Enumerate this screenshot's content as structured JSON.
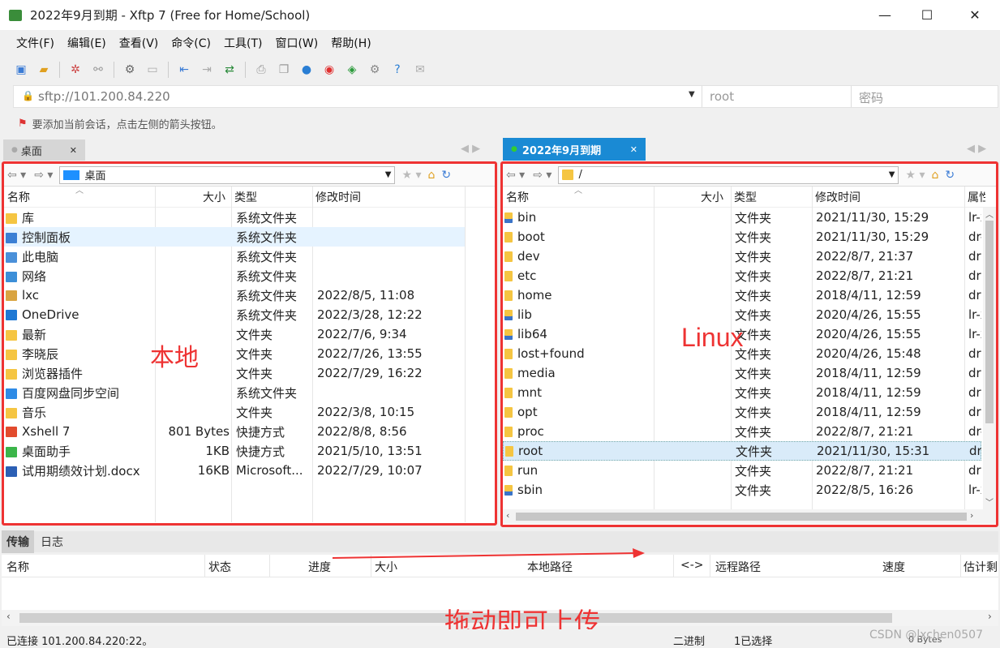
{
  "window": {
    "title": "2022年9月到期 - Xftp 7 (Free for Home/School)",
    "minimize": "—",
    "maximize": "☐",
    "close": "✕"
  },
  "menu": [
    "文件(F)",
    "编辑(E)",
    "查看(V)",
    "命令(C)",
    "工具(T)",
    "窗口(W)",
    "帮助(H)"
  ],
  "address": {
    "url": "sftp://101.200.84.220",
    "user": "root",
    "password_placeholder": "密码"
  },
  "hint": "要添加当前会话，点击左侧的箭头按钮。",
  "left": {
    "tab": "桌面",
    "path": "桌面",
    "columns": [
      "名称",
      "大小",
      "类型",
      "修改时间"
    ],
    "rows": [
      {
        "name": "库",
        "size": "",
        "type": "系统文件夹",
        "mtime": "",
        "icon": "library-icon",
        "color": "#f5c542"
      },
      {
        "name": "控制面板",
        "size": "",
        "type": "系统文件夹",
        "mtime": "",
        "icon": "control-panel-icon",
        "color": "#3b7fd4"
      },
      {
        "name": "此电脑",
        "size": "",
        "type": "系统文件夹",
        "mtime": "",
        "icon": "computer-icon",
        "color": "#4a90d9"
      },
      {
        "name": "网络",
        "size": "",
        "type": "系统文件夹",
        "mtime": "",
        "icon": "network-icon",
        "color": "#3c8fd8"
      },
      {
        "name": "lxc",
        "size": "",
        "type": "系统文件夹",
        "mtime": "2022/8/5, 11:08",
        "icon": "user-folder-icon",
        "color": "#d9a441"
      },
      {
        "name": "OneDrive",
        "size": "",
        "type": "系统文件夹",
        "mtime": "2022/3/28, 12:22",
        "icon": "cloud-icon",
        "color": "#1e78d4"
      },
      {
        "name": "最新",
        "size": "",
        "type": "文件夹",
        "mtime": "2022/7/6, 9:34",
        "icon": "folder-icon",
        "color": "#f5c542"
      },
      {
        "name": "李晓辰",
        "size": "",
        "type": "文件夹",
        "mtime": "2022/7/26, 13:55",
        "icon": "folder-icon",
        "color": "#f5c542"
      },
      {
        "name": "浏览器插件",
        "size": "",
        "type": "文件夹",
        "mtime": "2022/7/29, 16:22",
        "icon": "folder-icon",
        "color": "#f5c542"
      },
      {
        "name": "百度网盘同步空间",
        "size": "",
        "type": "系统文件夹",
        "mtime": "",
        "icon": "baidu-sync-icon",
        "color": "#2e8be6"
      },
      {
        "name": "音乐",
        "size": "",
        "type": "文件夹",
        "mtime": "2022/3/8, 10:15",
        "icon": "folder-icon",
        "color": "#f5c542"
      },
      {
        "name": "Xshell 7",
        "size": "801 Bytes",
        "type": "快捷方式",
        "mtime": "2022/8/8, 8:56",
        "icon": "xshell-icon",
        "color": "#e24b2d"
      },
      {
        "name": "桌面助手",
        "size": "1KB",
        "type": "快捷方式",
        "mtime": "2021/5/10, 13:51",
        "icon": "assistant-icon",
        "color": "#3bb54a"
      },
      {
        "name": "试用期绩效计划.docx",
        "size": "16KB",
        "type": "Microsoft...",
        "mtime": "2022/7/29, 10:07",
        "icon": "word-doc-icon",
        "color": "#2b5fb4"
      }
    ],
    "annotation": "本地"
  },
  "right": {
    "tab": "2022年9月到期",
    "path": "/",
    "columns": [
      "名称",
      "大小",
      "类型",
      "修改时间",
      "属性"
    ],
    "rows": [
      {
        "name": "bin",
        "type": "文件夹",
        "mtime": "2021/11/30, 15:29",
        "attr": "lr-x",
        "link": true
      },
      {
        "name": "boot",
        "type": "文件夹",
        "mtime": "2021/11/30, 15:29",
        "attr": "dr-x",
        "link": false
      },
      {
        "name": "dev",
        "type": "文件夹",
        "mtime": "2022/8/7, 21:37",
        "attr": "drw",
        "link": false
      },
      {
        "name": "etc",
        "type": "文件夹",
        "mtime": "2022/8/7, 21:21",
        "attr": "drw",
        "link": false
      },
      {
        "name": "home",
        "type": "文件夹",
        "mtime": "2018/4/11, 12:59",
        "attr": "drw",
        "link": false
      },
      {
        "name": "lib",
        "type": "文件夹",
        "mtime": "2020/4/26, 15:55",
        "attr": "lr-x",
        "link": true
      },
      {
        "name": "lib64",
        "type": "文件夹",
        "mtime": "2020/4/26, 15:55",
        "attr": "lr-x",
        "link": true
      },
      {
        "name": "lost+found",
        "type": "文件夹",
        "mtime": "2020/4/26, 15:48",
        "attr": "drw",
        "link": false
      },
      {
        "name": "media",
        "type": "文件夹",
        "mtime": "2018/4/11, 12:59",
        "attr": "drw",
        "link": false
      },
      {
        "name": "mnt",
        "type": "文件夹",
        "mtime": "2018/4/11, 12:59",
        "attr": "drw",
        "link": false
      },
      {
        "name": "opt",
        "type": "文件夹",
        "mtime": "2018/4/11, 12:59",
        "attr": "drw",
        "link": false
      },
      {
        "name": "proc",
        "type": "文件夹",
        "mtime": "2022/8/7, 21:21",
        "attr": "dr-x",
        "link": false
      },
      {
        "name": "root",
        "type": "文件夹",
        "mtime": "2021/11/30, 15:31",
        "attr": "dr-x",
        "link": false
      },
      {
        "name": "run",
        "type": "文件夹",
        "mtime": "2022/8/7, 21:21",
        "attr": "drw",
        "link": false
      },
      {
        "name": "sbin",
        "type": "文件夹",
        "mtime": "2022/8/5, 16:26",
        "attr": "lr-x",
        "link": true
      }
    ],
    "annotation": "Linux"
  },
  "transfer": {
    "tabs": [
      "传输",
      "日志"
    ],
    "columns": [
      "名称",
      "状态",
      "进度",
      "大小",
      "本地路径",
      "<->",
      "远程路径",
      "速度",
      "估计剩"
    ],
    "annotation": "拖动即可上传"
  },
  "status": {
    "connected": "已连接 101.200.84.220:22。",
    "mode": "二进制",
    "selection": "1已选择",
    "watermark": "CSDN @lxchen0507",
    "size": "0 Bytes"
  },
  "colors": {
    "accent": "#1a8ad4",
    "annotation_red": "#e33333",
    "selected_row": "#e5f3ff"
  }
}
